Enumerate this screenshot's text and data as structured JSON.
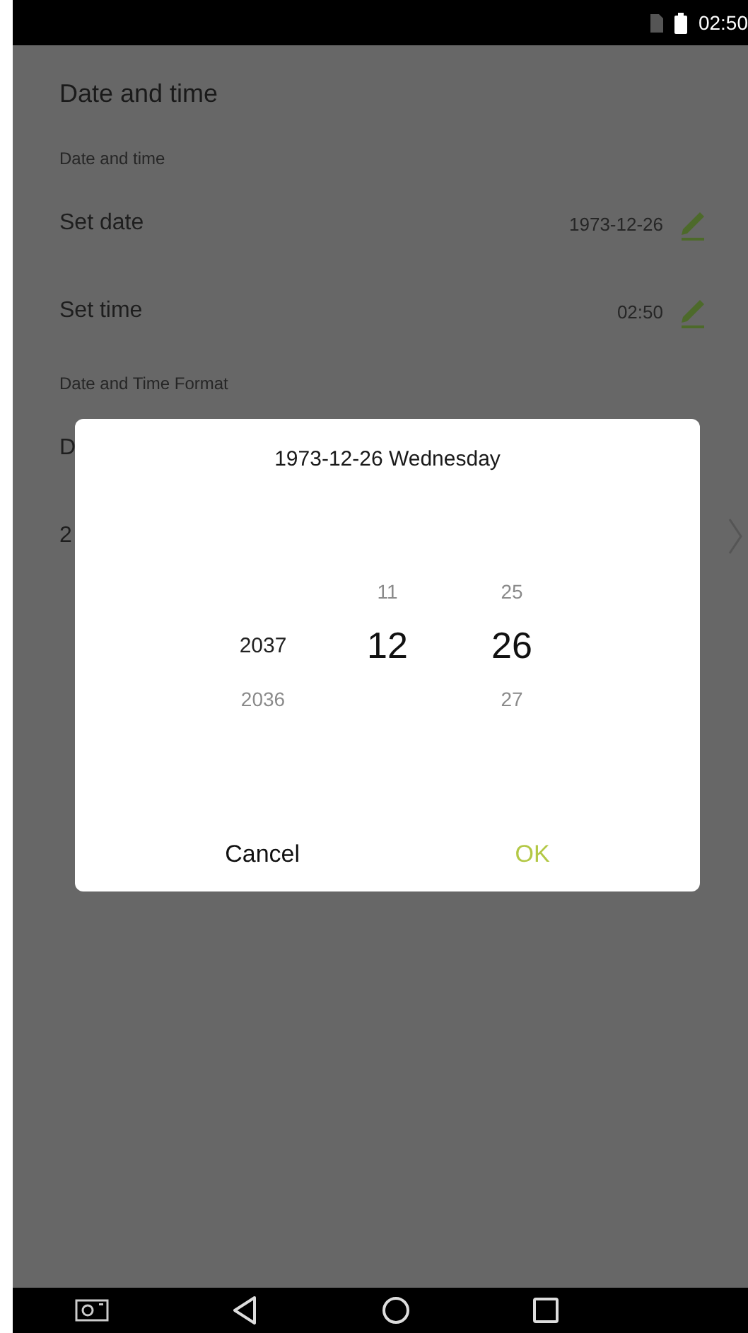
{
  "status_bar": {
    "time": "02:50"
  },
  "page": {
    "title": "Date and time",
    "sections": [
      {
        "header": "Date and time",
        "rows": [
          {
            "label": "Set date",
            "value": "1973-12-26"
          },
          {
            "label": "Set time",
            "value": "02:50"
          }
        ]
      },
      {
        "header": "Date and Time Format",
        "rows": [
          {
            "label": "D"
          },
          {
            "label": "2",
            "chevron": true
          }
        ]
      }
    ]
  },
  "dialog": {
    "title": "1973-12-26 Wednesday",
    "columns": [
      {
        "current": "2037",
        "below": "2036"
      },
      {
        "above": "11",
        "current": "12"
      },
      {
        "above": "25",
        "current": "26",
        "below": "27"
      }
    ],
    "buttons": [
      {
        "label": "Cancel",
        "kind": "cancel"
      },
      {
        "label": "OK",
        "kind": "confirm"
      }
    ]
  }
}
